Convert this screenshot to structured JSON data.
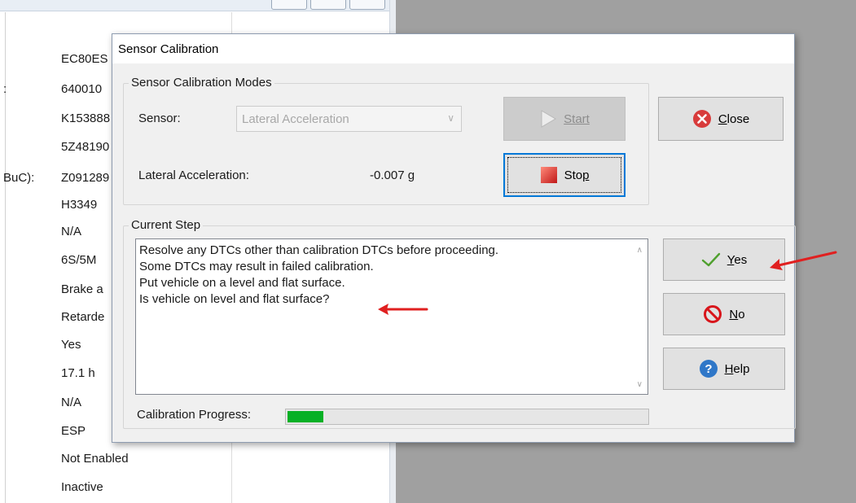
{
  "background_window": {
    "rows": [
      {
        "label": "",
        "value": "EC80ES"
      },
      {
        "label": ":",
        "value": "640010"
      },
      {
        "label": "",
        "value": "K153888"
      },
      {
        "label": "",
        "value": "5Z48190"
      },
      {
        "label": "BuC):",
        "value": "Z091289"
      },
      {
        "label": "",
        "value": "H3349"
      },
      {
        "label": "",
        "value": "N/A"
      },
      {
        "label": "",
        "value": "6S/5M"
      },
      {
        "label": "",
        "value": "Brake a"
      },
      {
        "label": "",
        "value": "Retarde"
      },
      {
        "label": "",
        "value": "Yes"
      },
      {
        "label": "",
        "value": "17.1    h"
      },
      {
        "label": "",
        "value": "N/A"
      },
      {
        "label": "",
        "value": "ESP"
      },
      {
        "label": "",
        "value": "Not Enabled"
      },
      {
        "label": "",
        "value": "Inactive"
      }
    ]
  },
  "dialog": {
    "title": "Sensor Calibration",
    "modes_group": {
      "title": "Sensor Calibration Modes",
      "sensor_label": "Sensor:",
      "sensor_selected": "Lateral Acceleration",
      "reading_label": "Lateral Acceleration:",
      "reading_value": "-0.007 g",
      "start_label": "Start",
      "stop_label": "Stop"
    },
    "close_label": "Close",
    "current_step": {
      "title": "Current Step",
      "lines": [
        "Resolve any DTCs other than calibration DTCs before proceeding.",
        "Some DTCs may result in failed calibration.",
        "Put vehicle on a level and flat surface.",
        "Is vehicle on level and flat surface?"
      ]
    },
    "progress": {
      "label": "Calibration Progress:",
      "fraction": 0.1
    },
    "yes_label": "Yes",
    "no_label": "No",
    "help_label": "Help"
  },
  "icons": {
    "start": "play-arrow-icon",
    "stop": "stop-square-icon",
    "close": "close-circle-icon",
    "yes": "checkmark-icon",
    "no": "no-entry-icon",
    "help": "help-circle-icon",
    "annotation": "red-arrow-icon"
  },
  "colors": {
    "progress_fill": "#06b025",
    "annotation_arrow": "#e02020",
    "focus_border": "#0078d7",
    "close_icon": "#d83b3b",
    "help_icon": "#2f77c8"
  }
}
